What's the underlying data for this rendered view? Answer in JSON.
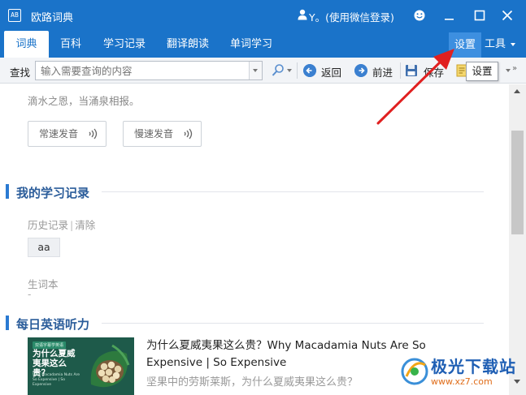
{
  "window": {
    "app_title": "欧路词典",
    "logo_text": "AB",
    "user_label": "Y。(使用微信登录)"
  },
  "tabs": [
    {
      "label": "词典",
      "active": true
    },
    {
      "label": "百科"
    },
    {
      "label": "学习记录"
    },
    {
      "label": "翻译朗读"
    },
    {
      "label": "单词学习"
    }
  ],
  "right_tabs": {
    "settings_label": "设置",
    "tools_label": "工具"
  },
  "toolbar": {
    "find_label": "查找",
    "search_placeholder": "输入需要查询的内容",
    "back_label": "返回",
    "forward_label": "前进",
    "save_label": "保存"
  },
  "tooltip": {
    "text": "设置"
  },
  "content": {
    "proverb": "滴水之恩，当涌泉相报。",
    "normal_pron_label": "常速发音",
    "slow_pron_label": "慢速发音",
    "learning_section_title": "我的学习记录",
    "history_label": "历史记录",
    "history_separator": "|",
    "clear_label": "清除",
    "history_items": [
      "aa"
    ],
    "vocab_label": "生词本",
    "vocab_empty": "-",
    "listening_section_title": "每日英语听力",
    "article_title": "为什么夏威夷果这么贵？Why Macadamia Nuts Are So Expensive | So Expensive",
    "article_subtitle": "坚果中的劳斯莱斯，为什么夏威夷果这么贵？",
    "thumbnail": {
      "tag": "双语字幕学英语",
      "title": "为什么夏威夷果这么贵？",
      "subtitle": "Why Macadamia Nuts Are So Expensive | So Expensive"
    }
  },
  "watermark": {
    "brand": "极光下载站",
    "url": "www.xz7.com"
  },
  "colors": {
    "titlebar": "#1a73c9",
    "settings_highlight": "#3d8fe0",
    "section_accent": "#2a7ad2",
    "arrow": "#e02020"
  }
}
